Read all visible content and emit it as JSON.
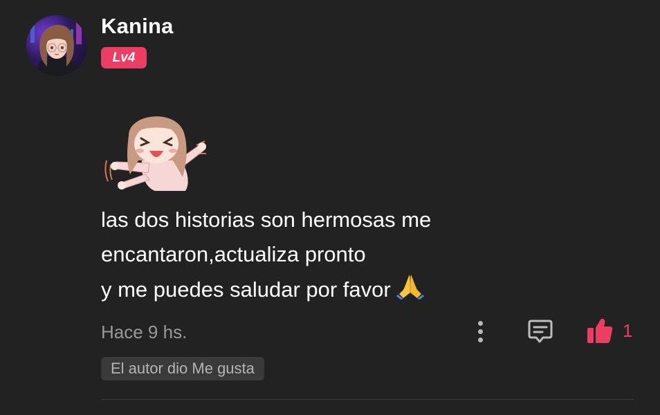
{
  "comment": {
    "author": {
      "name": "Kanina",
      "level_badge": "Lv4",
      "avatar_icon": "user-avatar-icon"
    },
    "sticker_icon": "chibi-sticker-icon",
    "text_lines": [
      "las dos historias son hermosas me",
      "encantaron,actualiza pronto",
      "y me puedes saludar por favor"
    ],
    "emoji_icon": "praying-hands-icon",
    "timestamp": "Hace 9 hs.",
    "actions": {
      "more_icon": "more-vertical-icon",
      "reply_icon": "comment-icon",
      "like_icon": "thumbs-up-icon",
      "like_count": "1"
    },
    "author_liked_label": "El autor dio Me gusta"
  },
  "colors": {
    "background": "#222222",
    "accent": "#ec3d62",
    "muted_text": "#9a9a9a",
    "chip_background": "#3a3a3a"
  }
}
